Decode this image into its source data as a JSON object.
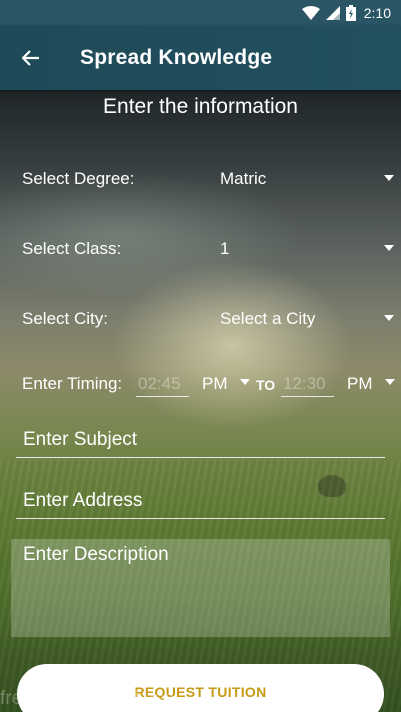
{
  "status_bar": {
    "time": "2:10"
  },
  "app_bar": {
    "title": "Spread Knowledge"
  },
  "form": {
    "heading": "Enter the information",
    "degree": {
      "label": "Select Degree:",
      "value": "Matric"
    },
    "class": {
      "label": "Select Class:",
      "value": "1"
    },
    "city": {
      "label": "Select City:",
      "value": "Select a City"
    },
    "timing": {
      "label": "Enter Timing:",
      "from_placeholder": "02:45",
      "from_ampm": "PM",
      "separator": "TO",
      "to_placeholder": "12:30",
      "to_ampm": "PM"
    },
    "subject_placeholder": "Enter Subject",
    "address_placeholder": "Enter Address",
    "description_placeholder": "Enter Description",
    "submit_label": "REQUEST TUITION"
  },
  "watermark": "free for personal use",
  "colors": {
    "app_bar": "#21505f",
    "status_bar": "#2a5564",
    "button_text": "#c79a16"
  }
}
